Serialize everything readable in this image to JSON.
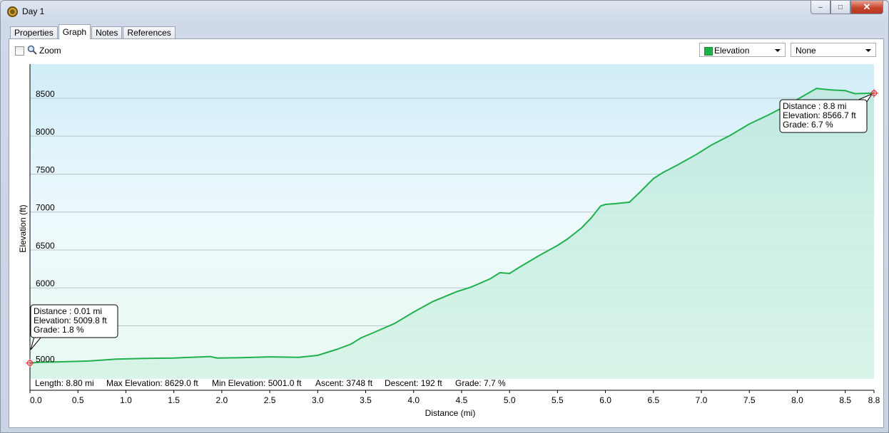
{
  "window": {
    "title": "Day 1",
    "buttons": {
      "minimize": "–",
      "maximize": "□",
      "close": "✕"
    }
  },
  "tabs": [
    "Properties",
    "Graph",
    "Notes",
    "References"
  ],
  "active_tab": "Graph",
  "toolbar": {
    "zoom_label": "Zoom",
    "zoom_checked": false,
    "series_select": "Elevation",
    "second_select": "None"
  },
  "colors": {
    "line": "#20b04c",
    "plot_bg_top": "#d2eef7",
    "plot_bg_bottom": "#e4f8ef",
    "marker": "#e03030"
  },
  "tooltips": {
    "start": [
      "Distance : 0.01 mi",
      "Elevation: 5009.8 ft",
      "Grade: 1.8 %"
    ],
    "end": [
      "Distance : 8.8 mi",
      "Elevation: 8566.7 ft",
      "Grade: 6.7 %"
    ]
  },
  "summary": {
    "length": "Length: 8.80 mi",
    "max_elevation": "Max Elevation: 8629.0 ft",
    "min_elevation": "Min Elevation: 5001.0 ft",
    "ascent": "Ascent: 3748 ft",
    "descent": "Descent: 192 ft",
    "grade": "Grade: 7.7 %"
  },
  "chart_data": {
    "type": "area",
    "xlabel": "Distance  (mi)",
    "ylabel": "Elevation (ft)",
    "xlim": [
      0,
      8.8
    ],
    "ylim": [
      4650,
      8950
    ],
    "x_ticks": [
      "0.0",
      "0.5",
      "1.0",
      "1.5",
      "2.0",
      "2.5",
      "3.0",
      "3.5",
      "4.0",
      "4.5",
      "5.0",
      "5.5",
      "6.0",
      "6.5",
      "7.0",
      "7.5",
      "8.0",
      "8.5",
      "8.8"
    ],
    "x_tick_values": [
      0,
      0.5,
      1,
      1.5,
      2,
      2.5,
      3,
      3.5,
      4,
      4.5,
      5,
      5.5,
      6,
      6.5,
      7,
      7.5,
      8,
      8.5,
      8.8
    ],
    "y_ticks": [
      5000,
      5500,
      6000,
      6500,
      7000,
      7500,
      8000,
      8500
    ],
    "grid": true,
    "series": [
      {
        "x": [
          0,
          0.1,
          0.3,
          0.6,
          0.9,
          1.2,
          1.5,
          1.8,
          1.88,
          1.95,
          2.2,
          2.5,
          2.8,
          3.0,
          3.2,
          3.35,
          3.45,
          3.6,
          3.8,
          4.0,
          4.2,
          4.45,
          4.6,
          4.8,
          4.9,
          5.0,
          5.1,
          5.3,
          5.5,
          5.6,
          5.75,
          5.85,
          5.95,
          6.0,
          6.1,
          6.25,
          6.35,
          6.5,
          6.6,
          6.75,
          6.95,
          7.1,
          7.3,
          7.5,
          7.7,
          7.9,
          8.05,
          8.2,
          8.35,
          8.5,
          8.6,
          8.8
        ],
        "y": [
          5009.8,
          5020,
          5025,
          5035,
          5060,
          5070,
          5075,
          5090,
          5095,
          5075,
          5080,
          5090,
          5085,
          5110,
          5190,
          5260,
          5340,
          5420,
          5530,
          5680,
          5820,
          5950,
          6010,
          6120,
          6200,
          6190,
          6270,
          6420,
          6560,
          6640,
          6790,
          6920,
          7080,
          7100,
          7110,
          7130,
          7250,
          7440,
          7520,
          7620,
          7760,
          7880,
          8010,
          8160,
          8280,
          8410,
          8520,
          8629,
          8610,
          8600,
          8560,
          8566.7
        ]
      }
    ]
  }
}
